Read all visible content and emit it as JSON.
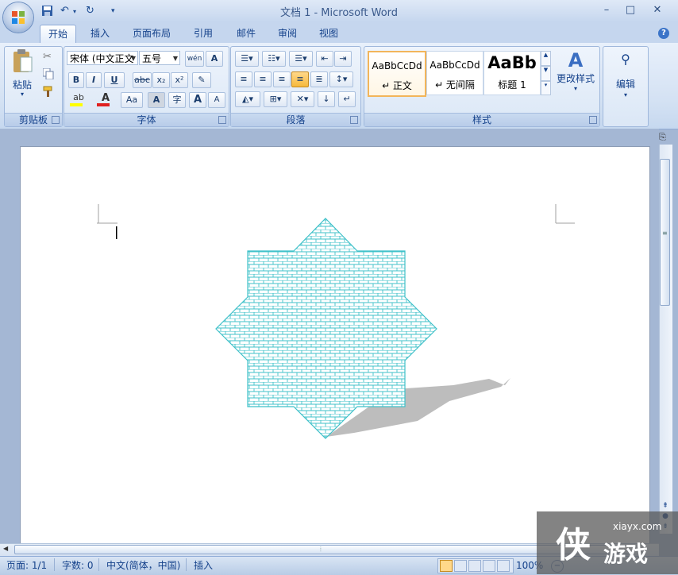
{
  "app": {
    "title": "文档 1 - Microsoft Word"
  },
  "qat": {
    "save_icon": "save-icon",
    "undo_icon": "undo-icon",
    "redo_icon": "redo-icon",
    "customize_icon": "customize-qat-icon"
  },
  "window": {
    "minimize": "–",
    "maximize": "□",
    "close": "✕"
  },
  "tabs": [
    {
      "label": "开始",
      "active": true
    },
    {
      "label": "插入"
    },
    {
      "label": "页面布局"
    },
    {
      "label": "引用"
    },
    {
      "label": "邮件"
    },
    {
      "label": "审阅"
    },
    {
      "label": "视图"
    }
  ],
  "help": "?",
  "ribbon": {
    "clipboard": {
      "label": "剪贴板",
      "paste": "粘贴",
      "paste_arrow": "▾"
    },
    "font": {
      "label": "字体",
      "font_name": "宋体 (中文正文",
      "font_size": "五号",
      "bold": "B",
      "italic": "I",
      "underline": "U",
      "strike": "abc",
      "subscript": "x₂",
      "superscript": "x²",
      "change_case": "Aa",
      "char_shading": "A",
      "grow": "A",
      "shrink": "A",
      "phonetic": "wén",
      "enclose": "字",
      "border_char": "A"
    },
    "paragraph": {
      "label": "段落"
    },
    "styles": {
      "label": "样式",
      "items": [
        {
          "sample": "AaBbCcDd",
          "name": "↵ 正文",
          "selected": true
        },
        {
          "sample": "AaBbCcDd",
          "name": "↵ 无间隔"
        },
        {
          "sample": "AaBb",
          "name": "标题 1"
        }
      ],
      "change_styles": "更改样式"
    },
    "editing": {
      "label": "编辑"
    }
  },
  "statusbar": {
    "page": "页面: 1/1",
    "words": "字数: 0",
    "language": "中文(简体，中国)",
    "mode": "插入",
    "zoom": "100%",
    "zoom_percent": 100
  },
  "watermark": {
    "site": "xiayx.com",
    "name": "游戏",
    "logo": "侠"
  },
  "colors": {
    "shape_fill": "#3fc1c9",
    "shape_shadow": "#bdbdbd",
    "accent": "#15428b",
    "active_style_border": "#f2b55a"
  }
}
